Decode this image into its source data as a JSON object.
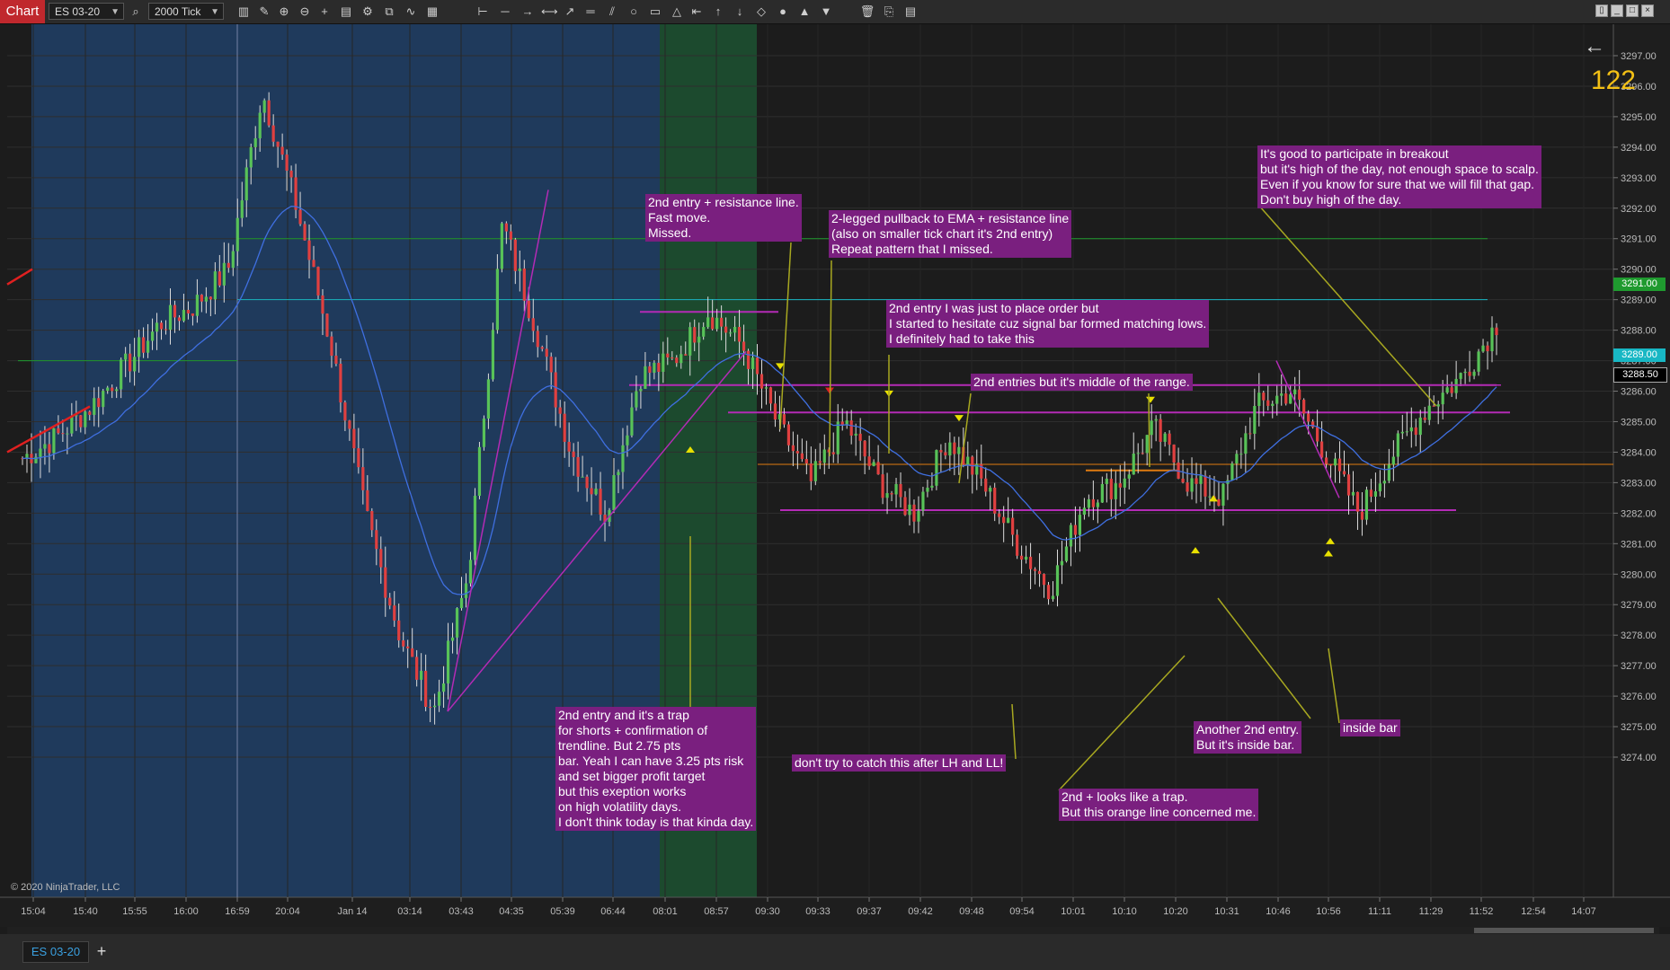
{
  "toolbar": {
    "tab_label": "Chart",
    "instrument": "ES 03-20",
    "interval": "2000 Tick",
    "icons": [
      "bar-style-icon",
      "draw-icon",
      "zoom-in-icon",
      "zoom-out-icon",
      "crosshair-icon",
      "data-box-icon",
      "properties-icon",
      "indicators-icon",
      "strategies-icon",
      "chart-trader-icon",
      "ruler-icon",
      "line-icon",
      "ray-icon",
      "extended-line-icon",
      "arrow-line-icon",
      "horizontal-line-icon",
      "fib-icon",
      "ellipse-icon",
      "rectangle-icon",
      "triangle-icon",
      "arrow-left-icon",
      "arrow-up-icon",
      "arrow-down-icon",
      "diamond-icon",
      "dot-icon",
      "triangle-up-icon",
      "triangle-down-icon",
      "trash-icon",
      "copy-icon",
      "template-icon"
    ]
  },
  "chart": {
    "bar_counter": "122",
    "copyright": "© 2020 NinjaTrader, LLC",
    "y_axis_ticks": [
      "3297.00",
      "3296.00",
      "3295.00",
      "3294.00",
      "3293.00",
      "3292.00",
      "3291.00",
      "3290.00",
      "3289.00",
      "3288.00",
      "3287.00",
      "3286.00",
      "3285.00",
      "3284.00",
      "3283.00",
      "3282.00",
      "3281.00",
      "3280.00",
      "3279.00",
      "3278.00",
      "3277.00",
      "3276.00",
      "3275.00",
      "3274.00"
    ],
    "x_axis_ticks": [
      "15:04",
      "15:40",
      "15:55",
      "16:00",
      "16:59",
      "20:04",
      "Jan 14",
      "03:14",
      "03:43",
      "04:35",
      "05:39",
      "06:44",
      "08:01",
      "08:57",
      "09:30",
      "09:33",
      "09:37",
      "09:42",
      "09:48",
      "09:54",
      "10:01",
      "10:10",
      "10:20",
      "10:31",
      "10:46",
      "10:56",
      "11:11",
      "11:29",
      "11:52",
      "12:54",
      "14:07"
    ],
    "price_labels": [
      {
        "text": "3291.00",
        "color": "#1f9a2f"
      },
      {
        "text": "3289.00",
        "color": "#18b7c4"
      },
      {
        "text": "3288.50",
        "color": "#000000"
      }
    ],
    "colors": {
      "up_bar": "#58c258",
      "down_bar": "#e04040",
      "ema": "#3f6fe0",
      "overnight": "#1f3a5c",
      "open_zone": "#1c4a2e",
      "note_bg": "#7a1f7f",
      "marker": "#e8e000"
    }
  },
  "notes": [
    {
      "id": "n1",
      "text": "2nd entry + resistance line.\nFast move.\nMissed."
    },
    {
      "id": "n2",
      "text": "2-legged pullback to EMA + resistance line\n(also on smaller tick chart it's 2nd entry)\nRepeat pattern that I missed."
    },
    {
      "id": "n3",
      "text": "2nd entry I was just to place order but\nI started to hesitate cuz signal bar formed matching lows.\nI definitely had to take this"
    },
    {
      "id": "n4",
      "text": "2nd entries but it's middle of the range."
    },
    {
      "id": "n5",
      "text": "It's good to participate in breakout\nbut it's high of the day, not enough space to scalp.\nEven if you know for sure that we will fill that gap.\nDon't buy high of the day."
    },
    {
      "id": "n6",
      "text": "2nd entry and it's a trap\nfor shorts + confirmation of\ntrendline. But 2.75 pts\nbar. Yeah I can have 3.25 pts risk\nand set bigger profit target\nbut this exeption works\non high volatility days.\nI don't think today is that kinda day."
    },
    {
      "id": "n7",
      "text": "don't try to catch this after LH and LL!"
    },
    {
      "id": "n8",
      "text": "2nd + looks like a trap.\nBut this orange line concerned me."
    },
    {
      "id": "n9",
      "text": "Another 2nd entry.\nBut it's inside bar."
    },
    {
      "id": "n10",
      "text": "inside bar"
    }
  ],
  "chart_data": {
    "type": "candlestick",
    "ylim": [
      3274,
      3297.5
    ],
    "x": [
      "15:04",
      "15:40",
      "15:55",
      "16:00",
      "16:59",
      "20:04",
      "Jan 14",
      "03:14",
      "03:43",
      "04:35",
      "05:39",
      "06:44",
      "08:01",
      "08:57",
      "09:30",
      "09:33",
      "09:37",
      "09:42",
      "09:48",
      "09:54",
      "10:01",
      "10:10",
      "10:20",
      "10:31",
      "10:46",
      "10:56",
      "11:11",
      "11:29",
      "11:52"
    ],
    "close_path": [
      3283.8,
      3284.5,
      3285.5,
      3286.8,
      3288.2,
      3288.8,
      3290.0,
      3295.8,
      3292.0,
      3287.5,
      3282.0,
      3278.0,
      3275.5,
      3280.0,
      3291.5,
      3288.0,
      3284.0,
      3282.0,
      3286.5,
      3287.0,
      3288.6,
      3287.5,
      3285.0,
      3283.0,
      3285.0,
      3283.0,
      3282.0,
      3284.5,
      3283.0,
      3281.0,
      3279.5,
      3282.5,
      3283.0,
      3284.8,
      3283.0,
      3282.5,
      3285.5,
      3286.0,
      3284.0,
      3282.0,
      3284.0,
      3285.5,
      3286.5,
      3288.2
    ],
    "horizontal_levels": [
      {
        "price": 3291.0,
        "color": "#1f9a2f"
      },
      {
        "price": 3289.0,
        "color": "#18b7c4"
      },
      {
        "price": 3285.3,
        "color": "#b32bb5"
      },
      {
        "price": 3282.1,
        "color": "#b32bb5"
      },
      {
        "price": 3283.6,
        "color": "#e07b10"
      },
      {
        "price": 3286.2,
        "color": "#b32bb5"
      }
    ]
  }
}
